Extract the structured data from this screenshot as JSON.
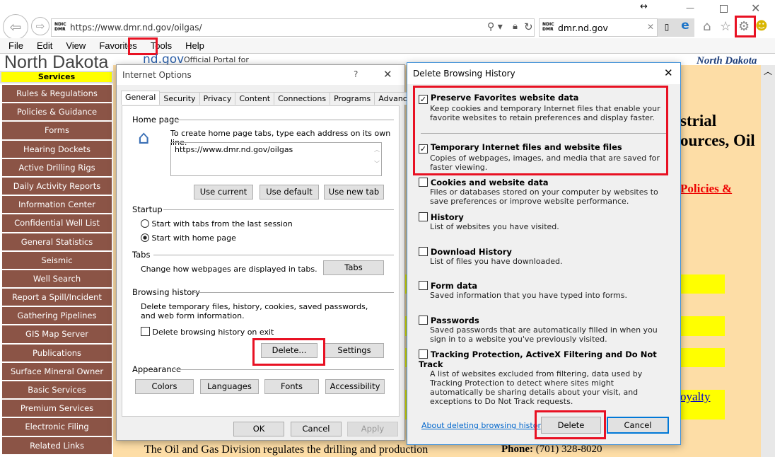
{
  "browser": {
    "url": "https://www.dmr.nd.gov/oilgas/",
    "tab_title": "dmr.nd.gov",
    "site_badge": "NDIC DMR",
    "menu": [
      "File",
      "Edit",
      "View",
      "Favorites",
      "Tools",
      "Help"
    ]
  },
  "site": {
    "heading": "North Dakota",
    "portal_brand": "nd.gov",
    "portal_text": "Official Portal for",
    "logo_text": "North Dakota LEGENDARY",
    "sidebar_header": "Services",
    "sidebar": [
      "Rules & Regulations",
      "Policies & Guidance",
      "Forms",
      "Hearing Dockets",
      "Active Drilling Rigs",
      "Daily Activity Reports",
      "Information Center",
      "Confidential Well List",
      "General Statistics",
      "Seismic",
      "Well Search",
      "Report a Spill/Incident",
      "Gathering Pipelines",
      "GIS Map Server",
      "Publications",
      "Surface Mineral Owner",
      "Basic Services",
      "Premium Services",
      "Electronic Filing",
      "Related Links"
    ],
    "title_frag1": "strial",
    "title_frag2": "ources, Oil",
    "policies_link": "Policies &",
    "royalty_link": "oyalty",
    "body_text": "The Oil and Gas Division regulates the drilling and production",
    "phone_label": "Phone:",
    "phone": "(701) 328-8020"
  },
  "internet_options": {
    "title": "Internet Options",
    "help": "?",
    "tabs": [
      "General",
      "Security",
      "Privacy",
      "Content",
      "Connections",
      "Programs",
      "Advanced"
    ],
    "home_page_label": "Home page",
    "home_page_desc": "To create home page tabs, type each address on its own line.",
    "home_page_value": "https://www.dmr.nd.gov/oilgas",
    "use_current": "Use current",
    "use_default": "Use default",
    "use_new_tab": "Use new tab",
    "startup_label": "Startup",
    "startup_opt1": "Start with tabs from the last session",
    "startup_opt2": "Start with home page",
    "startup_selected": "Start with home page",
    "tabs_label": "Tabs",
    "tabs_desc": "Change how webpages are displayed in tabs.",
    "tabs_btn": "Tabs",
    "history_label": "Browsing history",
    "history_desc": "Delete temporary files, history, cookies, saved passwords, and web form information.",
    "delete_on_exit": "Delete browsing history on exit",
    "delete_on_exit_checked": false,
    "delete_btn": "Delete...",
    "settings_btn": "Settings",
    "appearance_label": "Appearance",
    "colors": "Colors",
    "languages": "Languages",
    "fonts": "Fonts",
    "accessibility": "Accessibility",
    "ok": "OK",
    "cancel": "Cancel",
    "apply": "Apply"
  },
  "delete_history": {
    "title": "Delete Browsing History",
    "items": [
      {
        "label": "Preserve Favorites website data",
        "desc": "Keep cookies and temporary Internet files that enable your favorite websites to retain preferences and display faster.",
        "checked": true
      },
      {
        "label": "Temporary Internet files and website files",
        "desc": "Copies of webpages, images, and media that are saved for faster viewing.",
        "checked": true
      },
      {
        "label": "Cookies and website data",
        "desc": "Files or databases stored on your computer by websites to save preferences or improve website performance.",
        "checked": false
      },
      {
        "label": "History",
        "desc": "List of websites you have visited.",
        "checked": false
      },
      {
        "label": "Download History",
        "desc": "List of files you have downloaded.",
        "checked": false
      },
      {
        "label": "Form data",
        "desc": "Saved information that you have typed into forms.",
        "checked": false
      },
      {
        "label": "Passwords",
        "desc": "Saved passwords that are automatically filled in when you sign in to a website you've previously visited.",
        "checked": false
      },
      {
        "label": "Tracking Protection, ActiveX Filtering and Do Not Track",
        "desc": "A list of websites excluded from filtering, data used by Tracking Protection to detect where sites might automatically be sharing details about your visit, and exceptions to Do Not Track requests.",
        "checked": false
      }
    ],
    "about_link": "About deleting browsing history",
    "delete": "Delete",
    "cancel": "Cancel"
  },
  "colors": {
    "highlight": "#e81123",
    "sidebar": "#8b5446",
    "page_bg": "#fddda6",
    "yellow": "#ffff00",
    "link": "#0066cc"
  }
}
